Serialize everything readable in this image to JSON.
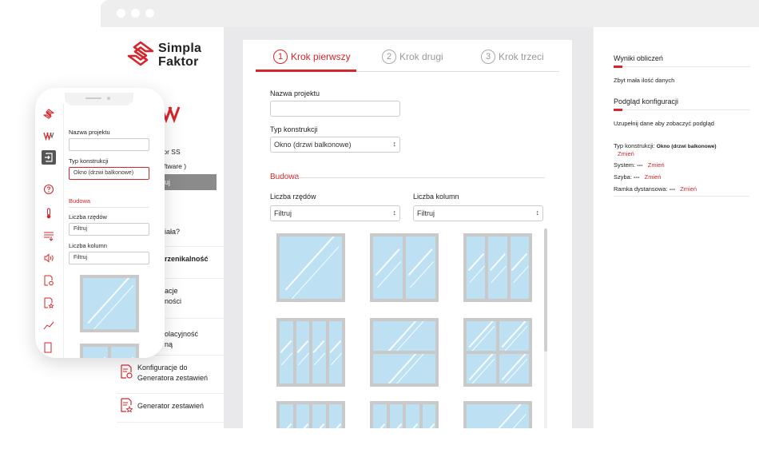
{
  "brand": {
    "name_line1": "Simpla",
    "name_line2": "Faktor",
    "accent": "#d7262b"
  },
  "steps": [
    {
      "num": "1",
      "label": "Krok pierwszy",
      "active": true
    },
    {
      "num": "2",
      "label": "Krok drugi",
      "active": false
    },
    {
      "num": "3",
      "label": "Krok trzeci",
      "active": false
    }
  ],
  "form": {
    "project_name_label": "Nazwa projektu",
    "project_name_value": "",
    "construction_type_label": "Typ konstrukcji",
    "construction_type_value": "Okno (drzwi balkonowe)",
    "section_title": "Budowa",
    "rows_label": "Liczba rzędów",
    "rows_value": "Filtruj",
    "cols_label": "Liczba kolumn",
    "cols_value": "Filtruj"
  },
  "sidebar": {
    "partial_texts": [
      "tor SS",
      "oftware )",
      "uj",
      "iała?",
      "rzenikalność",
      "acje",
      "ności",
      "olacyjność",
      "ną"
    ],
    "items": [
      {
        "icon": "config-generator-icon",
        "label_line1": "Konfiguracje do",
        "label_line2": "Generatora zestawień"
      },
      {
        "icon": "set-generator-icon",
        "label_line1": "Generator zestawień",
        "label_line2": ""
      }
    ]
  },
  "results": {
    "title1": "Wyniki obliczeń",
    "text1": "Zbyt mała ilość danych",
    "title2": "Podgląd konfiguracji",
    "text2": "Uzupełnij dane aby zobaczyć podgląd",
    "construction_label": "Typ konstrukcji:",
    "construction_value": "Okno (drzwi balkonowe)",
    "change": "Zmień",
    "system_label": "System:",
    "system_value": "---",
    "glass_label": "Szyba:",
    "glass_value": "---",
    "spacer_label": "Ramka dystansowa:",
    "spacer_value": "---"
  },
  "phone": {
    "project_name_label": "Nazwa projektu",
    "construction_type_label": "Typ konstrukcji",
    "construction_type_value": "Okno (drzwi balkonowe)",
    "section_title": "Budowa",
    "rows_label": "Liczba rzędów",
    "rows_value": "Filtruj",
    "cols_label": "Liczba kolumn",
    "cols_value": "Filtruj"
  }
}
